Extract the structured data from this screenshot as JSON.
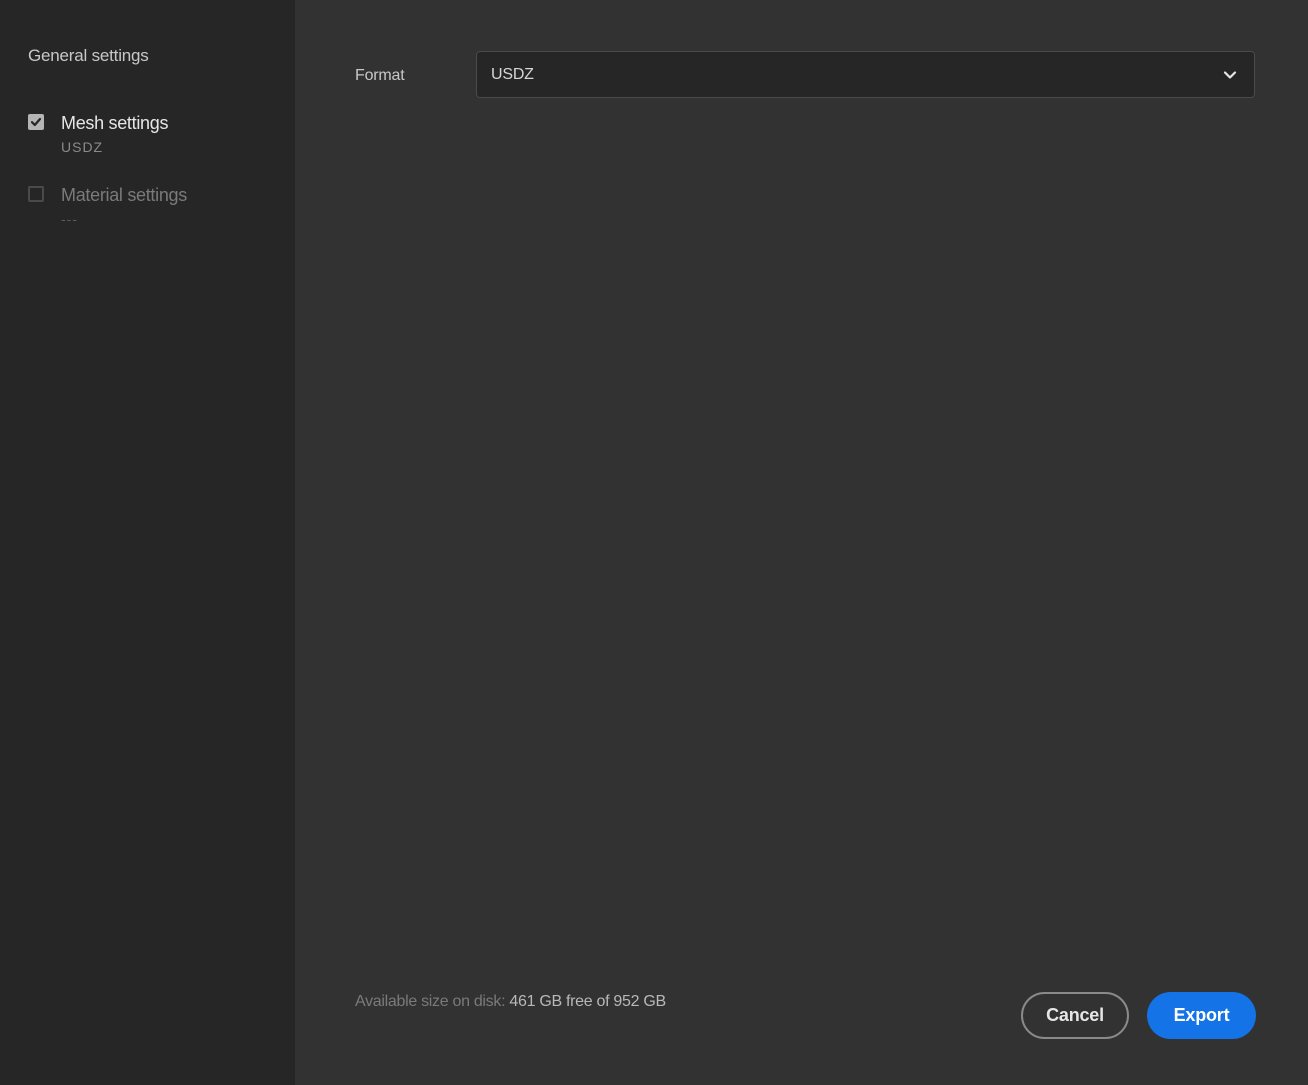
{
  "sidebar": {
    "title": "General settings",
    "items": [
      {
        "label": "Mesh settings",
        "sub": "USDZ",
        "checked": true
      },
      {
        "label": "Material settings",
        "sub": "---",
        "checked": false
      }
    ]
  },
  "main": {
    "format_label": "Format",
    "format_value": "USDZ",
    "disk_label": "Available size on disk:",
    "disk_value": "461 GB free of 952 GB"
  },
  "buttons": {
    "cancel": "Cancel",
    "export": "Export"
  },
  "colors": {
    "accent": "#1473e6",
    "sidebar_bg": "#262626",
    "main_bg": "#323232"
  },
  "icons": {
    "check": "checkmark-icon",
    "dropdown": "chevron-down-icon"
  }
}
